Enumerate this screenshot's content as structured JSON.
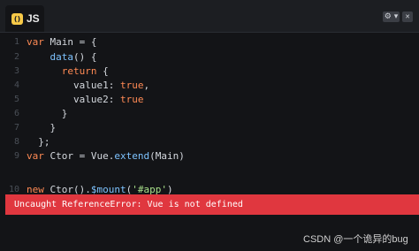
{
  "tab": {
    "icon_text": "()",
    "label": "JS"
  },
  "toolbar": {
    "settings_glyph": "⚙ ▾",
    "close_glyph": "✕"
  },
  "code_lines": [
    {
      "n": "1",
      "indent": "",
      "parts": [
        [
          "kw",
          "var"
        ],
        [
          "",
          " Main = {"
        ]
      ]
    },
    {
      "n": "2",
      "indent": "    ",
      "parts": [
        [
          "fn",
          "data"
        ],
        [
          "",
          "() {"
        ]
      ]
    },
    {
      "n": "3",
      "indent": "      ",
      "parts": [
        [
          "kw",
          "return"
        ],
        [
          "",
          " {"
        ]
      ]
    },
    {
      "n": "4",
      "indent": "        ",
      "parts": [
        [
          "",
          "value1: "
        ],
        [
          "kw",
          "true"
        ],
        [
          "",
          ","
        ]
      ]
    },
    {
      "n": "5",
      "indent": "        ",
      "parts": [
        [
          "",
          "value2: "
        ],
        [
          "kw",
          "true"
        ]
      ]
    },
    {
      "n": "6",
      "indent": "      ",
      "parts": [
        [
          "",
          "}"
        ]
      ]
    },
    {
      "n": "7",
      "indent": "    ",
      "parts": [
        [
          "",
          "}"
        ]
      ]
    },
    {
      "n": "8",
      "indent": "  ",
      "parts": [
        [
          "",
          "};"
        ]
      ]
    },
    {
      "n": "9",
      "indent": "",
      "parts": [
        [
          "kw",
          "var"
        ],
        [
          "",
          " Ctor = Vue."
        ],
        [
          "fn",
          "extend"
        ],
        [
          "",
          "(Main)"
        ]
      ]
    },
    {
      "n": "10",
      "indent": "",
      "parts": [
        [
          "kw",
          "new"
        ],
        [
          "",
          " Ctor()."
        ],
        [
          "fn",
          "$mount"
        ],
        [
          "",
          "("
        ],
        [
          "str",
          "'#app'"
        ],
        [
          "",
          ")"
        ]
      ]
    }
  ],
  "error": {
    "message": "Uncaught ReferenceError: Vue is not defined"
  },
  "watermark": {
    "text": "CSDN @一个诡异的bug"
  }
}
